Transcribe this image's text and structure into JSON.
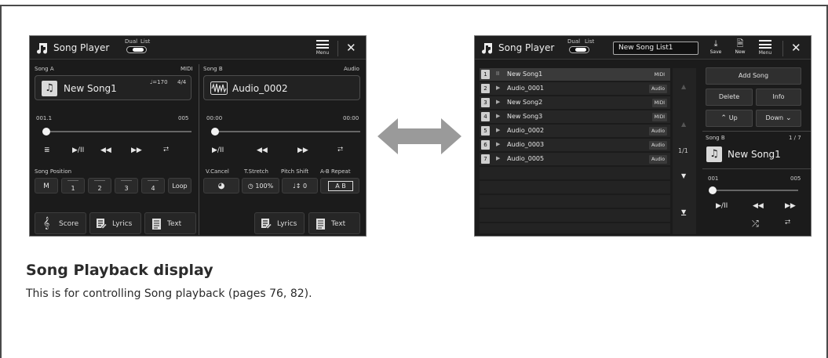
{
  "left": {
    "title": "Song Player",
    "dual": "Dual",
    "list": "List",
    "menu": "Menu",
    "close": "✕",
    "song_a": {
      "label": "Song A",
      "type": "MIDI",
      "name": "New Song1",
      "tempo": "♩=170",
      "time_sig": "4/4",
      "position": "001.1",
      "end": "005"
    },
    "song_b": {
      "label": "Song B",
      "type": "Audio",
      "name": "Audio_0002",
      "position": "00:00",
      "end": "00:00"
    },
    "song_position": "Song Position",
    "marker_buttons": [
      "M",
      "1",
      "2",
      "3",
      "4",
      "Loop"
    ],
    "vcancel": "V.Cancel",
    "tstretch": "T.Stretch",
    "pitchshift": "Pitch Shift",
    "abrepeat": "A-B Repeat",
    "tstretch_value": "100%",
    "pitch_value": "0",
    "ab_value": "A B",
    "score": "Score",
    "lyrics_a": "Lyrics",
    "text_a": "Text",
    "lyrics_b": "Lyrics",
    "text_b": "Text"
  },
  "right": {
    "title": "Song Player",
    "dual": "Dual",
    "list": "List",
    "list_name": "New Song List1",
    "save": "Save",
    "new": "New",
    "menu": "Menu",
    "close": "✕",
    "songs": [
      {
        "num": "1",
        "name": "New Song1",
        "type": "MIDI",
        "state": "II"
      },
      {
        "num": "2",
        "name": "Audio_0001",
        "type": "Audio",
        "state": "▶"
      },
      {
        "num": "3",
        "name": "New Song2",
        "type": "MIDI",
        "state": "▶"
      },
      {
        "num": "4",
        "name": "New Song3",
        "type": "MIDI",
        "state": "▶"
      },
      {
        "num": "5",
        "name": "Audio_0002",
        "type": "Audio",
        "state": "▶"
      },
      {
        "num": "6",
        "name": "Audio_0003",
        "type": "Audio",
        "state": "▶"
      },
      {
        "num": "7",
        "name": "Audio_0005",
        "type": "Audio",
        "state": "▶"
      }
    ],
    "page": "1/1",
    "add_song": "Add Song",
    "delete": "Delete",
    "info": "Info",
    "up": "Up",
    "down": "Down",
    "song_b_label": "Song B",
    "song_count": "1 / 7",
    "current_song": "New Song1",
    "position": "001",
    "end": "005"
  },
  "heading": "Song Playback display",
  "description": "This is for controlling Song playback (pages 76, 82)."
}
